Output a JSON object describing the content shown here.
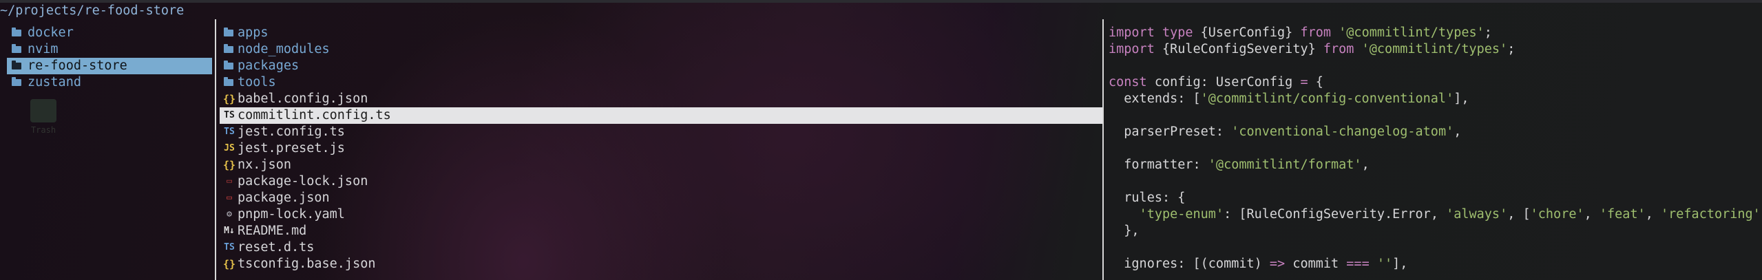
{
  "path": "~/projects/re-food-store",
  "parent_pane": {
    "items": [
      {
        "name": "docker",
        "kind": "dir"
      },
      {
        "name": "nvim",
        "kind": "dir"
      },
      {
        "name": "re-food-store",
        "kind": "dir",
        "selected": true
      },
      {
        "name": "zustand",
        "kind": "dir"
      }
    ],
    "desktop_ghost_label": "Trash"
  },
  "current_pane": {
    "items": [
      {
        "name": "apps",
        "kind": "dir",
        "icon": "folder-icon"
      },
      {
        "name": "node_modules",
        "kind": "dir",
        "icon": "folder-icon"
      },
      {
        "name": "packages",
        "kind": "dir",
        "icon": "folder-icon"
      },
      {
        "name": "tools",
        "kind": "dir",
        "icon": "folder-icon"
      },
      {
        "name": "babel.config.json",
        "kind": "file",
        "icon": "json-icon",
        "glyph": "{}",
        "color": "#e5c14a"
      },
      {
        "name": "commitlint.config.ts",
        "kind": "file",
        "icon": "typescript-icon",
        "glyph": "TS",
        "color": "#1c1c1c",
        "selected": true
      },
      {
        "name": "jest.config.ts",
        "kind": "file",
        "icon": "typescript-icon",
        "glyph": "TS",
        "color": "#6aa0d8"
      },
      {
        "name": "jest.preset.js",
        "kind": "file",
        "icon": "javascript-icon",
        "glyph": "JS",
        "color": "#e5c14a"
      },
      {
        "name": "nx.json",
        "kind": "file",
        "icon": "json-icon",
        "glyph": "{}",
        "color": "#e5c14a"
      },
      {
        "name": "package-lock.json",
        "kind": "file",
        "icon": "npm-lock-icon",
        "glyph": "▭",
        "color": "#b03a3a"
      },
      {
        "name": "package.json",
        "kind": "file",
        "icon": "npm-icon",
        "glyph": "▭",
        "color": "#d04040"
      },
      {
        "name": "pnpm-lock.yaml",
        "kind": "file",
        "icon": "gear-icon",
        "glyph": "⚙",
        "color": "#b8b8c0"
      },
      {
        "name": "README.md",
        "kind": "file",
        "icon": "markdown-icon",
        "glyph": "M↓",
        "color": "#e0e0e0"
      },
      {
        "name": "reset.d.ts",
        "kind": "file",
        "icon": "typescript-icon",
        "glyph": "TS",
        "color": "#6aa0d8"
      },
      {
        "name": "tsconfig.base.json",
        "kind": "file",
        "icon": "json-icon",
        "glyph": "{}",
        "color": "#e5c14a"
      }
    ]
  },
  "preview": {
    "lines": [
      [
        {
          "t": "import type ",
          "c": "kw"
        },
        {
          "t": "{UserConfig} ",
          "c": "plain"
        },
        {
          "t": "from ",
          "c": "kw"
        },
        {
          "t": "'@commitlint/types'",
          "c": "str"
        },
        {
          "t": ";",
          "c": "plain"
        }
      ],
      [
        {
          "t": "import ",
          "c": "kw"
        },
        {
          "t": "{RuleConfigSeverity} ",
          "c": "plain"
        },
        {
          "t": "from ",
          "c": "kw"
        },
        {
          "t": "'@commitlint/types'",
          "c": "str"
        },
        {
          "t": ";",
          "c": "plain"
        }
      ],
      [],
      [
        {
          "t": "const ",
          "c": "kw"
        },
        {
          "t": "config: UserConfig ",
          "c": "plain"
        },
        {
          "t": "= ",
          "c": "op"
        },
        {
          "t": "{",
          "c": "plain"
        }
      ],
      [
        {
          "t": "  extends: [",
          "c": "plain"
        },
        {
          "t": "'@commitlint/config-conventional'",
          "c": "str"
        },
        {
          "t": "],",
          "c": "plain"
        }
      ],
      [],
      [
        {
          "t": "  parserPreset: ",
          "c": "plain"
        },
        {
          "t": "'conventional-changelog-atom'",
          "c": "str"
        },
        {
          "t": ",",
          "c": "plain"
        }
      ],
      [],
      [
        {
          "t": "  formatter: ",
          "c": "plain"
        },
        {
          "t": "'@commitlint/format'",
          "c": "str"
        },
        {
          "t": ",",
          "c": "plain"
        }
      ],
      [],
      [
        {
          "t": "  rules: {",
          "c": "plain"
        }
      ],
      [
        {
          "t": "    ",
          "c": "plain"
        },
        {
          "t": "'type-enum'",
          "c": "str"
        },
        {
          "t": ": [RuleConfigSeverity.Error, ",
          "c": "plain"
        },
        {
          "t": "'always'",
          "c": "str"
        },
        {
          "t": ", [",
          "c": "plain"
        },
        {
          "t": "'chore'",
          "c": "str"
        },
        {
          "t": ", ",
          "c": "plain"
        },
        {
          "t": "'feat'",
          "c": "str"
        },
        {
          "t": ", ",
          "c": "plain"
        },
        {
          "t": "'refactoring'",
          "c": "str"
        },
        {
          "t": "]],",
          "c": "plain"
        }
      ],
      [
        {
          "t": "  },",
          "c": "plain"
        }
      ],
      [],
      [
        {
          "t": "  ignores: [(commit) ",
          "c": "plain"
        },
        {
          "t": "=> ",
          "c": "op"
        },
        {
          "t": "commit ",
          "c": "plain"
        },
        {
          "t": "=== ",
          "c": "op"
        },
        {
          "t": "''",
          "c": "str"
        },
        {
          "t": "],",
          "c": "plain"
        }
      ]
    ]
  }
}
